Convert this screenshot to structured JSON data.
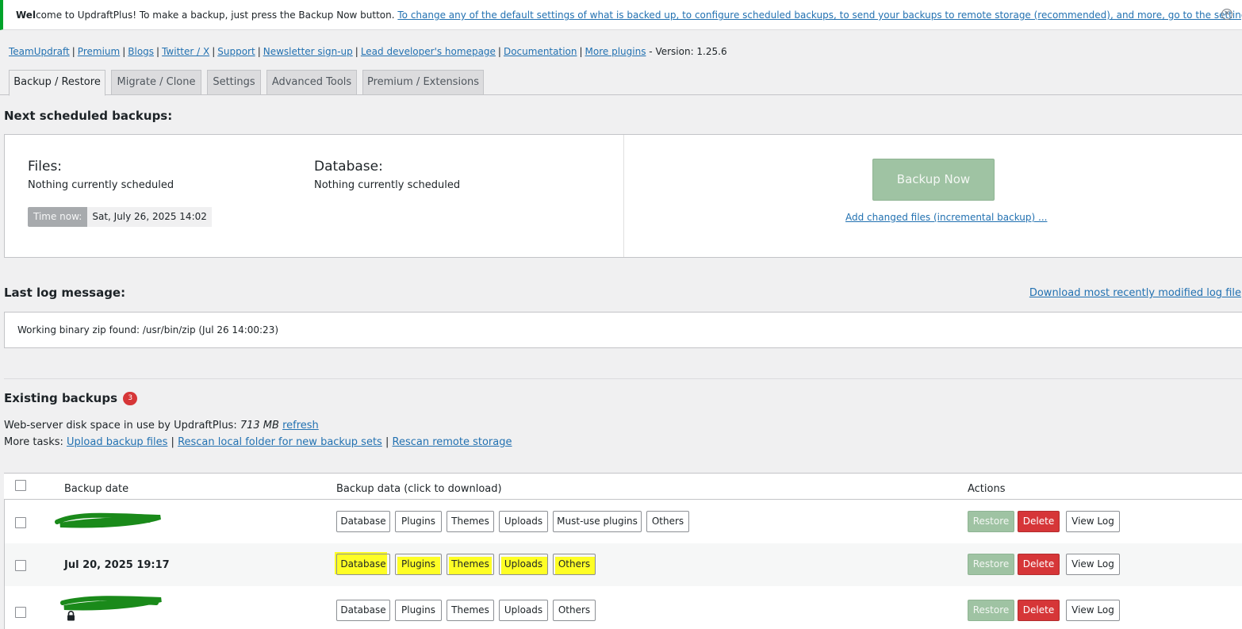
{
  "notice": {
    "bold_prefix": "Wel",
    "text": "come to UpdraftPlus! To make a backup, just press the Backup Now button. ",
    "link": "To change any of the default settings of what is backed up, to configure scheduled backups, to send your backups to remote storage (recommended), and more, go to the settings tab.",
    "dismiss_icon": "dismiss-icon"
  },
  "links": {
    "items": [
      "TeamUpdraft",
      "Premium",
      "Blogs",
      "Twitter / X",
      "Support",
      "Newsletter sign-up",
      "Lead developer's homepage",
      "Documentation",
      "More plugins"
    ],
    "version": "- Version: 1.25.6"
  },
  "tabs": [
    "Backup / Restore",
    "Migrate / Clone",
    "Settings",
    "Advanced Tools",
    "Premium / Extensions"
  ],
  "scheduled": {
    "heading": "Next scheduled backups:",
    "files_title": "Files:",
    "files_text": "Nothing currently scheduled",
    "db_title": "Database:",
    "db_text": "Nothing currently scheduled",
    "time_label": "Time now:",
    "time_value": "Sat, July 26, 2025 14:02",
    "backup_now": "Backup Now",
    "incremental": "Add changed files (incremental backup) ..."
  },
  "log": {
    "heading": "Last log message:",
    "download_link": "Download most recently modified log file",
    "message": "Working binary zip found: /usr/bin/zip (Jul 26 14:00:23)"
  },
  "existing": {
    "heading": "Existing backups",
    "count": "3",
    "disk_prefix": "Web-server disk space in use by UpdraftPlus: ",
    "disk_value": "713 MB",
    "refresh": "refresh",
    "tasks_prefix": "More tasks: ",
    "tasks": [
      "Upload backup files",
      "Rescan local folder for new backup sets",
      "Rescan remote storage"
    ]
  },
  "table": {
    "headers": [
      "Backup date",
      "Backup data (click to download)",
      "Actions"
    ],
    "rows": [
      {
        "date": "",
        "data": [
          "Database",
          "Plugins",
          "Themes",
          "Uploads",
          "Must-use plugins",
          "Others"
        ]
      },
      {
        "date": "Jul 20, 2025 19:17",
        "data": [
          "Database",
          "Plugins",
          "Themes",
          "Uploads",
          "Others"
        ]
      },
      {
        "date": "",
        "data": [
          "Database",
          "Plugins",
          "Themes",
          "Uploads",
          "Others"
        ]
      }
    ],
    "actions": {
      "restore": "Restore",
      "delete": "Delete",
      "view_log": "View Log"
    }
  },
  "colors": {
    "accent": "#2271b1",
    "notice_border": "#00a32a",
    "delete": "#d63638",
    "restore": "#9fc3a3",
    "highlight": "#ffff00"
  }
}
